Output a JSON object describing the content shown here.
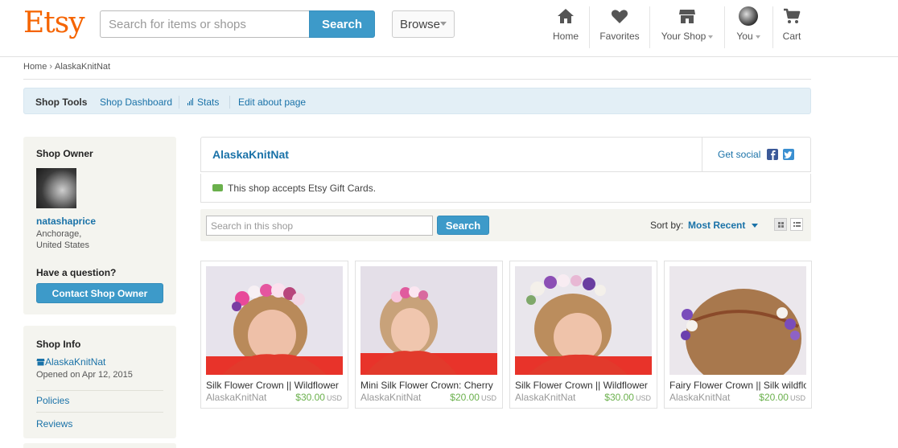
{
  "header": {
    "logo": "Etsy",
    "search_placeholder": "Search for items or shops",
    "search_button": "Search",
    "browse_button": "Browse",
    "nav": {
      "home": "Home",
      "favorites": "Favorites",
      "your_shop": "Your Shop",
      "you": "You",
      "cart": "Cart"
    }
  },
  "breadcrumb": {
    "home": "Home",
    "separator": "›",
    "current": "AlaskaKnitNat"
  },
  "shop_tools": {
    "title": "Shop Tools",
    "dashboard": "Shop Dashboard",
    "stats": "Stats",
    "edit_about": "Edit about page"
  },
  "sidebar": {
    "owner": {
      "heading": "Shop Owner",
      "username": "natashaprice",
      "location_line1": "Anchorage,",
      "location_line2": "United States",
      "question": "Have a question?",
      "contact_button": "Contact Shop Owner"
    },
    "info": {
      "heading": "Shop Info",
      "shop_name": "AlaskaKnitNat",
      "opened": "Opened on Apr 12, 2015",
      "policies": "Policies",
      "reviews": "Reviews"
    }
  },
  "shop": {
    "name": "AlaskaKnitNat",
    "get_social": "Get social",
    "gift_cards": "This shop accepts Etsy Gift Cards.",
    "search_placeholder": "Search in this shop",
    "search_button": "Search",
    "sort_label": "Sort by:",
    "sort_value": "Most Recent"
  },
  "listings": [
    {
      "title": "Silk Flower Crown || Wildflower",
      "shop": "AlaskaKnitNat",
      "price": "$30.00",
      "currency": "USD"
    },
    {
      "title": "Mini Silk Flower Crown: Cherry",
      "shop": "AlaskaKnitNat",
      "price": "$20.00",
      "currency": "USD"
    },
    {
      "title": "Silk Flower Crown || Wildflower",
      "shop": "AlaskaKnitNat",
      "price": "$30.00",
      "currency": "USD"
    },
    {
      "title": "Fairy Flower Crown || Silk wildflower",
      "shop": "AlaskaKnitNat",
      "price": "$20.00",
      "currency": "USD"
    }
  ],
  "colors": {
    "brand": "#f56400",
    "link": "#1a72a8",
    "button": "#3d9ac9",
    "price": "#6ab04c"
  }
}
